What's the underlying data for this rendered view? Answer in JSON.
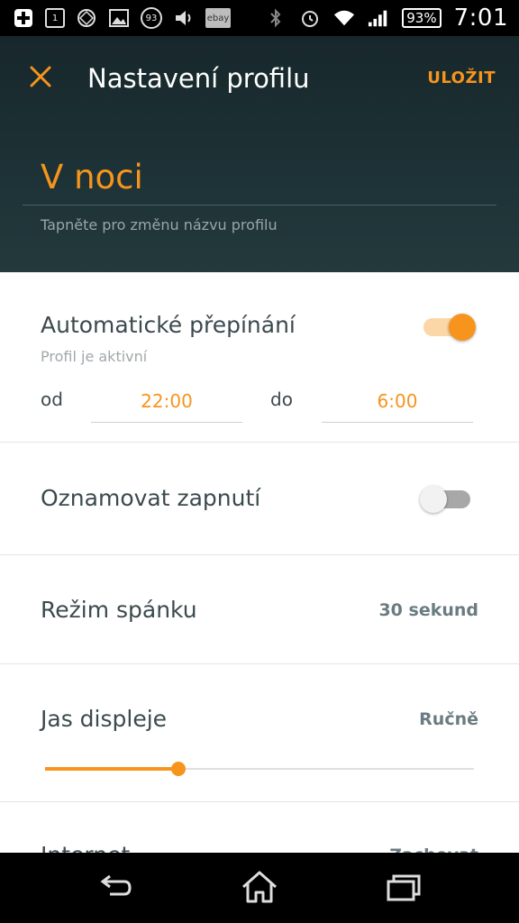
{
  "status_bar": {
    "notif_icons": [
      "plus-icon",
      "calendar-icon",
      "network-icon",
      "image-icon",
      "count-badge",
      "volume-icon",
      "ebay-icon"
    ],
    "calendar_day": "1",
    "count_badge": "93",
    "ebay_label": "ebay",
    "battery": "93%",
    "time": "7:01"
  },
  "header": {
    "title": "Nastavení profilu",
    "save_label": "ULOŽIT",
    "profile_name": "V noci",
    "name_hint": "Tapněte pro změnu názvu profilu"
  },
  "auto_switch": {
    "label": "Automatické přepínání",
    "sublabel": "Profil je aktivní",
    "enabled": true,
    "from_label": "od",
    "from_value": "22:00",
    "to_label": "do",
    "to_value": "6:00"
  },
  "notify": {
    "label": "Oznamovat zapnutí",
    "enabled": false
  },
  "sleep": {
    "label": "Režim spánku",
    "value": "30 sekund"
  },
  "brightness": {
    "label": "Jas displeje",
    "value": "Ručně",
    "level": 0.31
  },
  "internet": {
    "label": "Internet",
    "value": "Zachovat"
  },
  "colors": {
    "accent": "#f7941d",
    "header_bg": "#1d3236"
  }
}
